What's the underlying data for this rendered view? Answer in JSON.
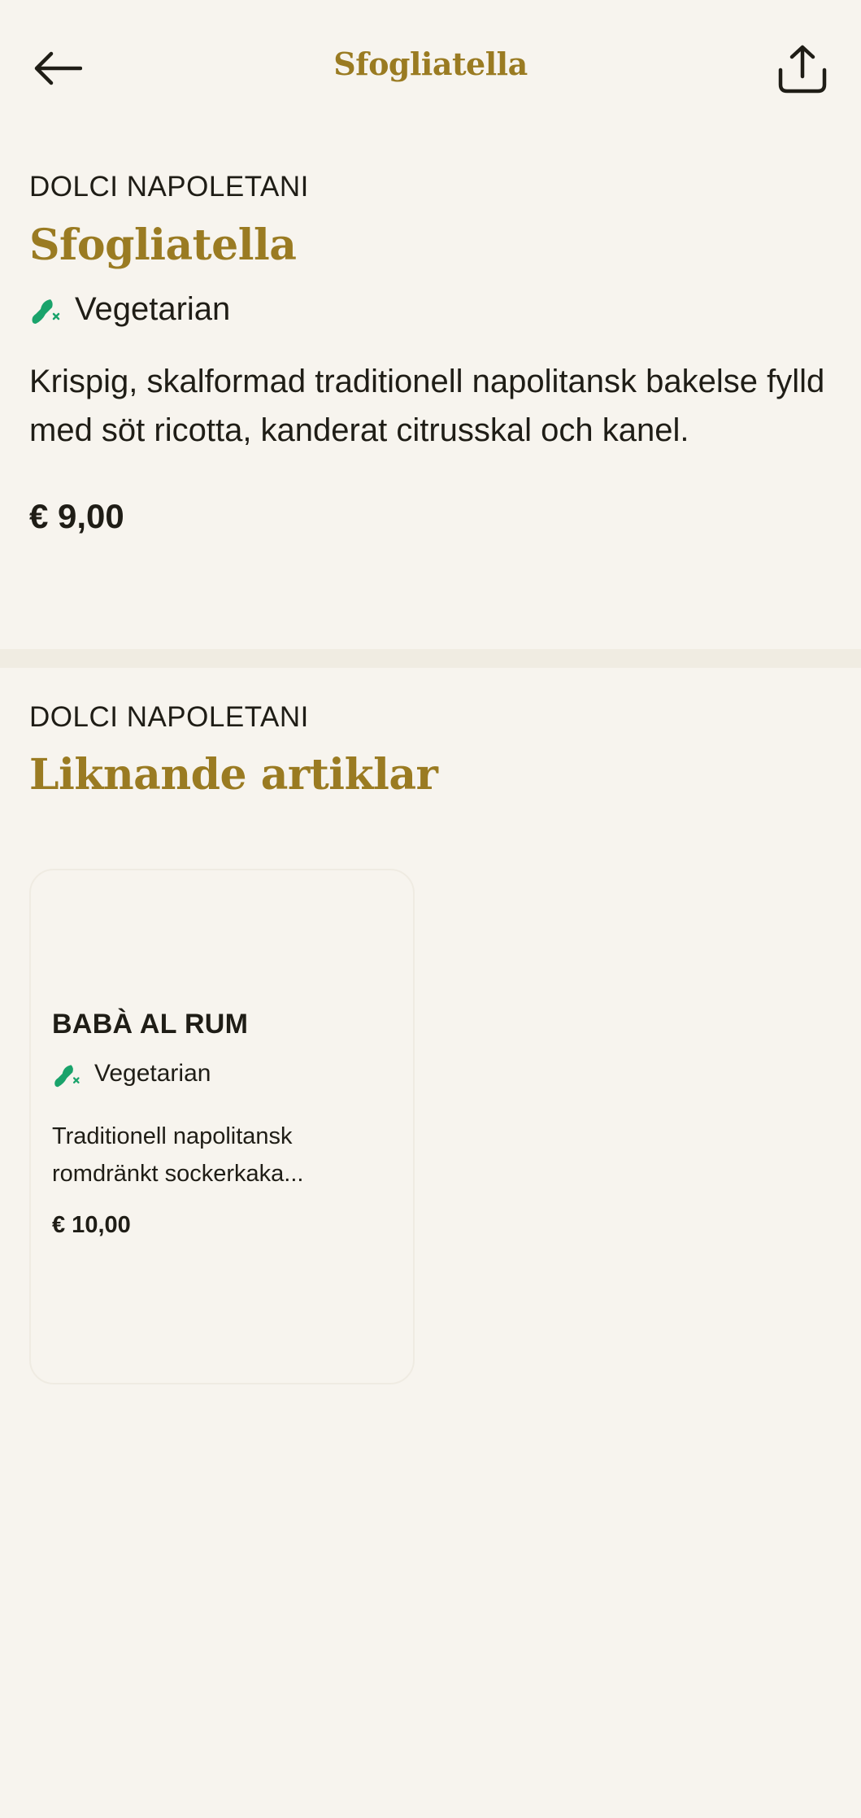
{
  "header": {
    "title": "Sfogliatella",
    "back_icon": "arrow-left-icon",
    "share_icon": "share-icon"
  },
  "item": {
    "category": "DOLCI NAPOLETANI",
    "title": "Sfogliatella",
    "diet": "Vegetarian",
    "diet_icon": "vegetarian-icon",
    "description": "Krispig, skalformad traditionell napolitansk bakelse fylld med söt ricotta, kanderat citrusskal och kanel.",
    "price": "€ 9,00"
  },
  "similar": {
    "category": "DOLCI NAPOLETANI",
    "title": "Liknande artiklar",
    "cards": [
      {
        "name": "BABÀ AL RUM",
        "diet": "Vegetarian",
        "description": "Traditionell napolitansk romdränkt sockerkaka...",
        "price": "€ 10,00"
      }
    ]
  },
  "colors": {
    "background": "#f7f4ee",
    "accent_gold": "#9a7b22",
    "text": "#1f1d16",
    "diet_green": "#1aa36b"
  }
}
